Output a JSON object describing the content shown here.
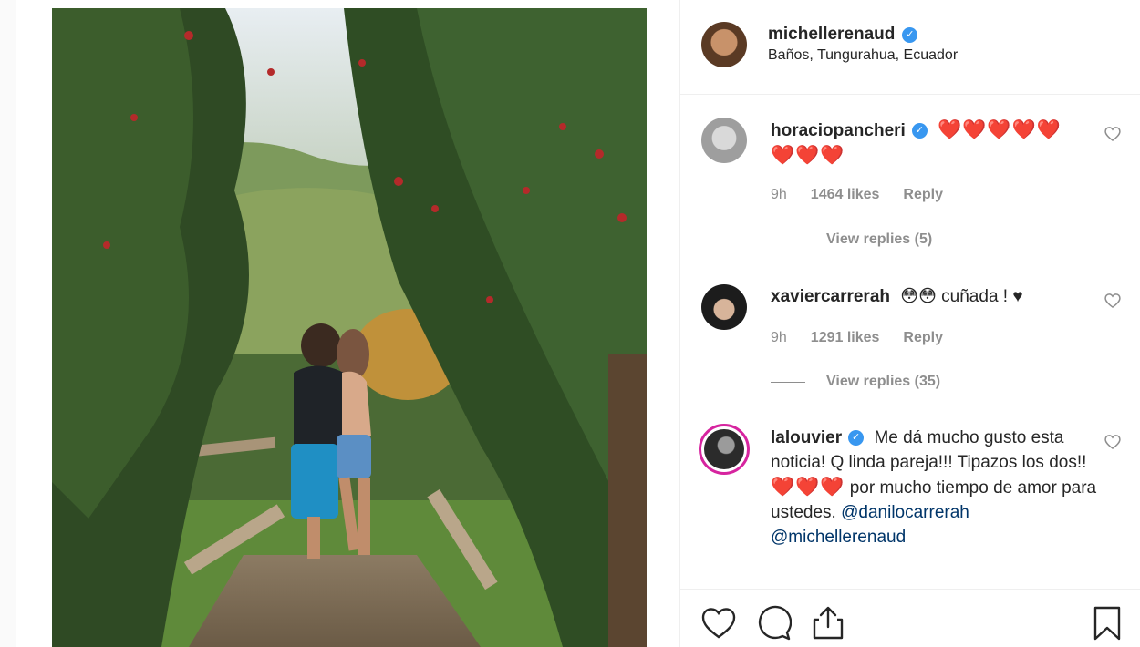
{
  "post": {
    "owner": {
      "username": "michellerenaud",
      "verified": true,
      "location": "Baños, Tungurahua, Ecuador"
    }
  },
  "comments": [
    {
      "username": "horaciopancheri",
      "verified": true,
      "text_line1": "❤️❤️❤️❤️❤️",
      "text_line2": "❤️❤️❤️",
      "time": "9h",
      "likes": "1464 likes",
      "reply": "Reply",
      "view_replies": "View replies (5)"
    },
    {
      "username": "xaviercarrerah",
      "verified": false,
      "text": "😳😳 cuñada ! ♥",
      "time": "9h",
      "likes": "1291 likes",
      "reply": "Reply",
      "view_replies": "View replies (35)"
    },
    {
      "username": "lalouvier",
      "verified": true,
      "text_a": "Me dá mucho gusto esta noticia! Q linda pareja!!! Tipazos los dos!!",
      "hearts": "❤️❤️❤️",
      "text_b": "por mucho tiempo de amor para ustedes.",
      "mention1": "@danilocarrerah",
      "mention2": "@michellerenaud"
    }
  ],
  "actions": {
    "icons": [
      "heart-icon",
      "comment-icon",
      "share-icon",
      "bookmark-icon"
    ]
  },
  "colors": {
    "verified": "#3897f0",
    "mention": "#003569",
    "muted": "#8e8e8e",
    "heart": "#ed2a2a"
  }
}
